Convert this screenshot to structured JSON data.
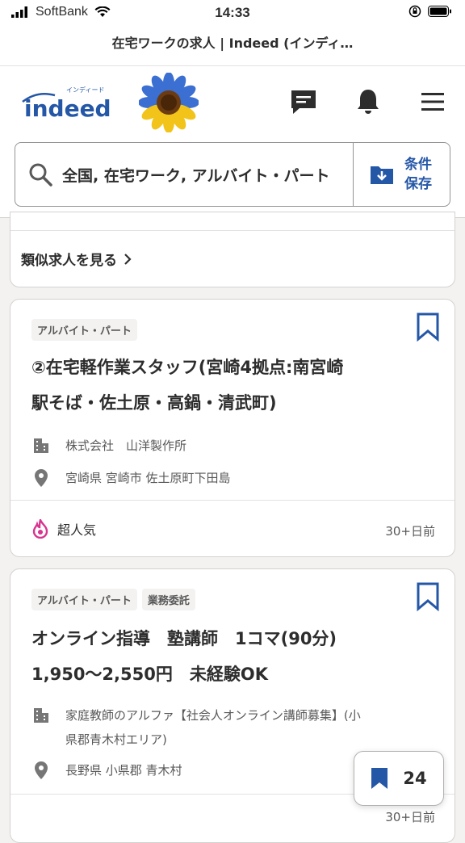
{
  "status_bar": {
    "carrier": "SoftBank",
    "time": "14:33"
  },
  "browser": {
    "page_title": "在宅ワークの求人 | Indeed (インディ…"
  },
  "header": {
    "logo_text": "indeed",
    "logo_kana": "インディード",
    "icons": [
      "message-icon",
      "bell-icon",
      "menu-icon"
    ]
  },
  "search": {
    "query": "全国, 在宅ワーク, アルバイト・パート",
    "save_label": "条件\n保存",
    "save_line1": "条件",
    "save_line2": "保存"
  },
  "similar_link": "類似求人を見る",
  "jobs": [
    {
      "tags": [
        "アルバイト・パート"
      ],
      "title_line1": "②在宅軽作業スタッフ(宮崎4拠点:南宮崎",
      "title_line2": "駅そば・佐土原・高鍋・清武町)",
      "company": "株式会社　山洋製作所",
      "location": "宮崎県 宮崎市 佐土原町下田島",
      "badge": "超人気",
      "posted": "30+日前"
    },
    {
      "tags": [
        "アルバイト・パート",
        "業務委託"
      ],
      "title_line1": "オンライン指導　塾講師　1コマ(90分)",
      "title_line2": "1,950〜2,550円　未経験OK",
      "company_line1": "家庭教師のアルファ【社会人オンライン講師募集】(小",
      "company_line2": "県郡青木村エリア)",
      "location": "長野県 小県郡 青木村",
      "posted": "30+日前"
    }
  ],
  "saved_jobs": {
    "count": "24"
  },
  "colors": {
    "brand_blue": "#2557a7",
    "text": "#2d2d2d",
    "hot": "#d8348f"
  }
}
